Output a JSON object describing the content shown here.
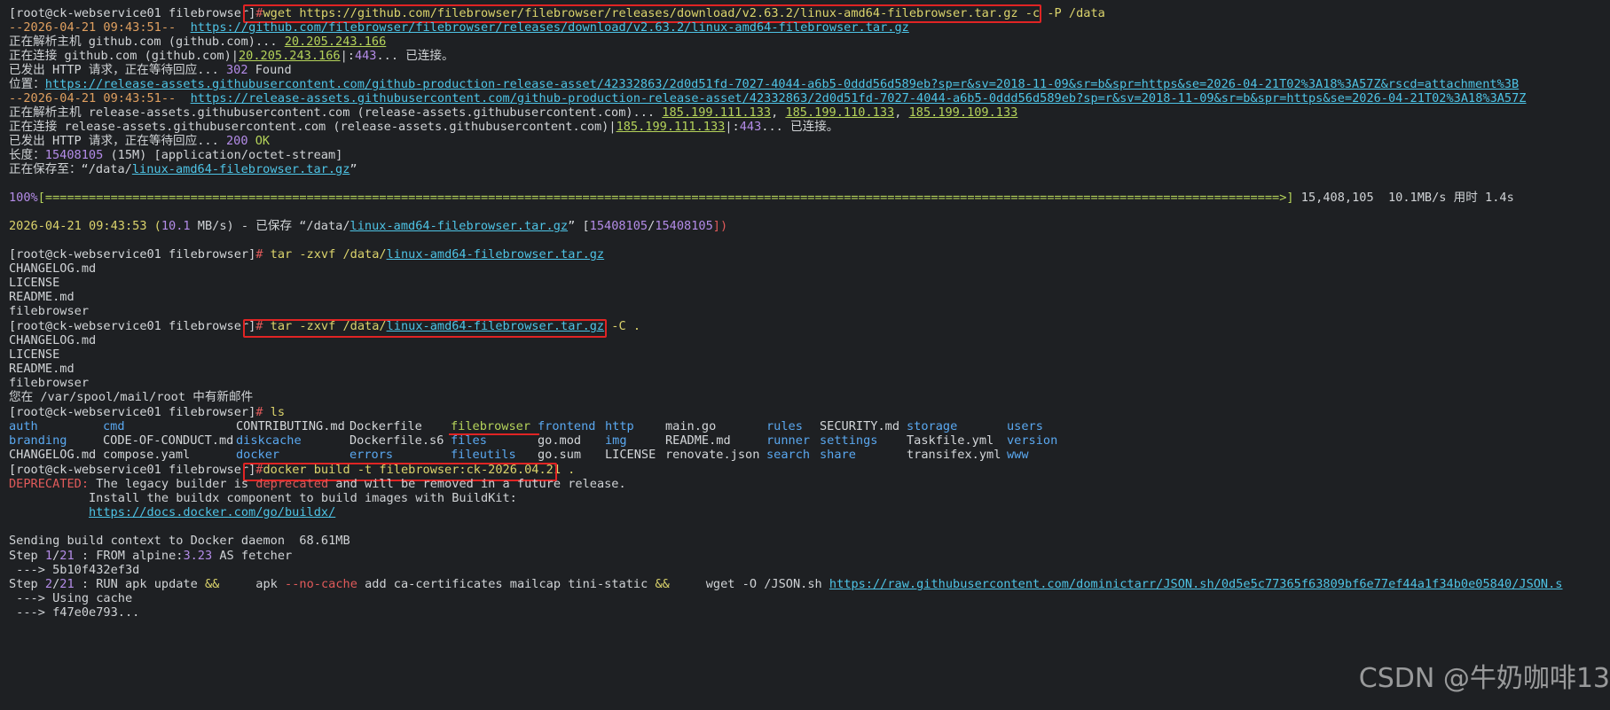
{
  "prompt": "[root@ck-webservice01 filebrowser]",
  "hash": "#",
  "lines": {
    "l1_cmd": "wget https://github.com/filebrowser/filebrowser/releases/download/v2.63.2/linux-amd64-filebrowser.tar.gz -c -P /data",
    "l2_a": "--2026-04-21 09:43:51--  ",
    "l2_b": "https://github.com/filebrowser/filebrowser/releases/download/v2.63.2/linux-amd64-filebrowser.tar.gz",
    "l3_a": "正在解析主机 github.com (github.com)... ",
    "l3_b": "20.205.243.166",
    "l4_a": "正在连接 github.com (github.com)|",
    "l4_b": "20.205.243.166",
    "l4_c": "|:",
    "l4_d": "443",
    "l4_e": "... 已连接。",
    "l5_a": "已发出 HTTP 请求，正在等待回应... ",
    "l5_b": "302",
    "l5_c": " Found",
    "l6_a": "位置：",
    "l6_b": "https://release-assets.githubusercontent.com/github-production-release-asset/42332863/2d0d51fd-7027-4044-a6b5-0ddd56d589eb?sp=r&sv=2018-11-09&sr=b&spr=https&se=2026-04-21T02%3A18%3A57Z&rscd=attachment%3B",
    "l7_a": "--2026-04-21 09:43:51--  ",
    "l7_b": "https://release-assets.githubusercontent.com/github-production-release-asset/42332863/2d0d51fd-7027-4044-a6b5-0ddd56d589eb?sp=r&sv=2018-11-09&sr=b&spr=https&se=2026-04-21T02%3A18%3A57Z",
    "l8_a": "正在解析主机 release-assets.githubusercontent.com (release-assets.githubusercontent.com)... ",
    "l8_b": "185.199.111.133",
    "l8_c": ", ",
    "l8_d": "185.199.110.133",
    "l8_e": ", ",
    "l8_f": "185.199.109.133",
    "l9_a": "正在连接 release-assets.githubusercontent.com (release-assets.githubusercontent.com)|",
    "l9_b": "185.199.111.133",
    "l9_c": "|:",
    "l9_d": "443",
    "l9_e": "... 已连接。",
    "l10_a": "已发出 HTTP 请求，正在等待回应... ",
    "l10_b": "200",
    "l10_c": " OK",
    "l11_a": "长度：",
    "l11_b": "15408105",
    "l11_c": " (15M) [application/octet-stream]",
    "l12_a": "正在保存至：“/data/",
    "l12_b": "linux-amd64-filebrowser.tar.gz",
    "l12_c": "”",
    "l13_a": "100%",
    "l13_b": "[==========================================================================================================================================================================>]",
    "l13_c": " 15,408,105  10.1MB/s 用时 1.4s",
    "l14_a": "2026-04-21 09:43:53 (",
    "l14_b": "10.1",
    "l14_c": " MB/s) - 已保存 “/data/",
    "l14_d": "linux-amd64-filebrowser.tar.gz",
    "l14_e": "” [",
    "l14_f": "15408105",
    "l14_g": "/",
    "l14_h": "15408105",
    "l14_i": "])",
    "l15_cmd1": "tar -zxvf /data/",
    "l15_cmd2": "linux-amd64-filebrowser.tar.gz",
    "out1": "CHANGELOG.md",
    "out2": "LICENSE",
    "out3": "README.md",
    "out4": "filebrowser",
    "l20_cmd1": "tar -zxvf /data/",
    "l20_cmd2": "linux-amd64-filebrowser.tar.gz",
    "l20_cmd3": " -C .",
    "mail": "您在 /var/spool/mail/root 中有新邮件",
    "ls_cmd": "ls",
    "docker_cmd": "docker build -t filebrowser:ck-2026.04.21 .",
    "dep_a": "DEPRECATED:",
    "dep_b": " The legacy builder is ",
    "dep_c": "deprecated",
    "dep_d": " and will be removed in a future release.",
    "dep2": "Install the buildx component to build images with BuildKit:",
    "dep3": "https://docs.docker.com/go/buildx/",
    "send": "Sending build context to Docker daemon  68.61MB",
    "step1_a": "Step ",
    "step1_b": "1",
    "step1_c": "/",
    "step1_d": "21",
    "step1_e": " : FROM alpine:",
    "step1_f": "3.23",
    "step1_g": " AS fetcher",
    "arrow1": " ---> 5b10f432ef3d",
    "step2_a": "Step ",
    "step2_b": "2",
    "step2_c": "/",
    "step2_d": "21",
    "step2_e": " : RUN apk update ",
    "step2_f": "&&",
    "step2_g": "     apk ",
    "step2_h": "--no-cache",
    "step2_i": " add ca-certificates mailcap tini-static ",
    "step2_j": "&&",
    "step2_k": "     wget -O /JSON.sh ",
    "step2_l": "https://raw.githubusercontent.com/dominictarr/JSON.sh/0d5e5c77365f63809bf6e77ef44a1f34b0e05840/JSON.s",
    "arrow2": " ---> Using cache",
    "arrow3": " ---> f47e0e793..."
  },
  "ls": {
    "row1": [
      "auth",
      "cmd",
      "CONTRIBUTING.md",
      "Dockerfile",
      "filebrowser",
      "frontend",
      "http",
      "main.go",
      "rules",
      "SECURITY.md",
      "storage",
      "users"
    ],
    "row2": [
      "branding",
      "CODE-OF-CONDUCT.md",
      "diskcache",
      "Dockerfile.s6",
      "files",
      "go.mod",
      "img",
      "README.md",
      "runner",
      "settings",
      "Taskfile.yml",
      "version"
    ],
    "row3": [
      "CHANGELOG.md",
      "compose.yaml",
      "docker",
      "errors",
      "fileutils",
      "go.sum",
      "LICENSE",
      "renovate.json",
      "search",
      "share",
      "transifex.yml",
      "www"
    ]
  },
  "watermark": "CSDN @牛奶咖啡13",
  "colors": {
    "background": "#1e2023",
    "highlight_box": "#e02424",
    "link": "#4ec4e6",
    "dir": "#5aa8f0"
  }
}
